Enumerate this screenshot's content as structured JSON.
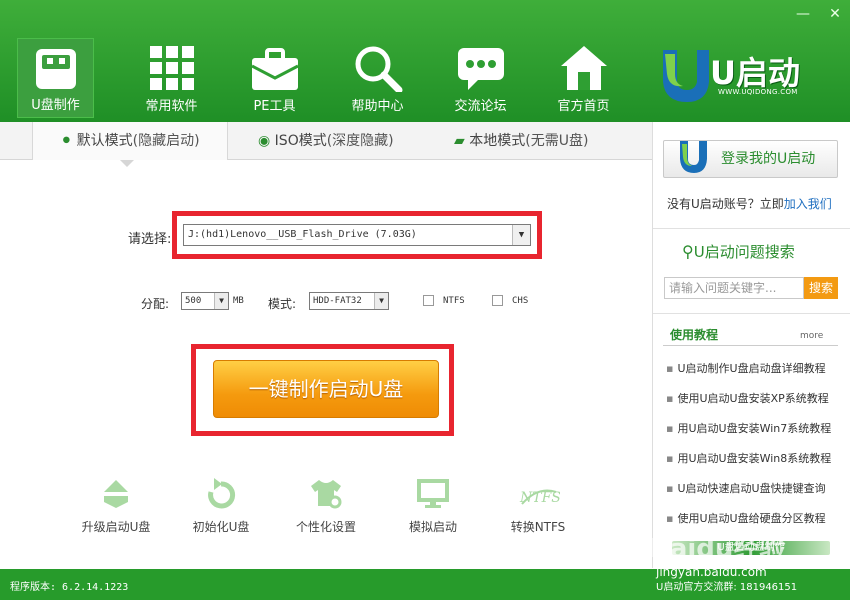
{
  "window": {
    "minimize_glyph": "—",
    "close_glyph": "✕"
  },
  "nav": {
    "items": [
      {
        "label": "U盘制作",
        "icon": "usb-drive-icon",
        "active": true
      },
      {
        "label": "常用软件",
        "icon": "grid-apps-icon",
        "active": false
      },
      {
        "label": "PE工具",
        "icon": "toolbox-icon",
        "active": false
      },
      {
        "label": "帮助中心",
        "icon": "magnifier-icon",
        "active": false
      },
      {
        "label": "交流论坛",
        "icon": "chat-bubble-icon",
        "active": false
      },
      {
        "label": "官方首页",
        "icon": "home-icon",
        "active": false
      }
    ]
  },
  "logo": {
    "text": "U启动",
    "url_text": "WWW.UQIDONG.COM"
  },
  "tabs": [
    {
      "label": "默认模式",
      "sub": "(隐藏启动)",
      "icon": "share-node-icon",
      "active": true
    },
    {
      "label": "ISO模式",
      "sub": "(深度隐藏)",
      "icon": "disc-icon",
      "active": false
    },
    {
      "label": "本地模式",
      "sub": "(无需U盘)",
      "icon": "hard-drive-icon",
      "active": false
    }
  ],
  "form": {
    "select_label": "请选择:",
    "drive_value": "J:(hd1)Lenovo__USB_Flash_Drive (7.03G)",
    "alloc_label": "分配:",
    "alloc_value": "500",
    "alloc_unit": "MB",
    "mode_label": "模式:",
    "mode_value": "HDD-FAT32",
    "ntfs_label": "NTFS",
    "ntfs_checked": false,
    "chs_label": "CHS",
    "chs_checked": false,
    "main_button": "一键制作启动U盘"
  },
  "tools": [
    {
      "label": "升级启动U盘",
      "icon": "upgrade-icon"
    },
    {
      "label": "初始化U盘",
      "icon": "reset-icon"
    },
    {
      "label": "个性化设置",
      "icon": "shirt-gear-icon"
    },
    {
      "label": "模拟启动",
      "icon": "monitor-icon"
    },
    {
      "label": "转换NTFS",
      "icon": "ntfs-icon"
    }
  ],
  "right": {
    "login_button": "登录我的U启动",
    "no_account_text": "没有U启动账号？立即",
    "join_link": "加入我们",
    "search_title": "U启动问题搜索",
    "search_placeholder": "请输入问题关键字...",
    "search_button": "搜索",
    "tutorial_title": "使用教程",
    "tutorial_more": "more",
    "tutorials": [
      "U启动制作U盘启动盘详细教程",
      "使用U启动U盘安装XP系统教程",
      "用U启动U盘安装Win7系统教程",
      "用U启动U盘安装Win8系统教程",
      "U启动快速启动U盘快捷键查询",
      "使用U启动U盘给硬盘分区教程"
    ],
    "bottom_bar": "U盘启动盘制作"
  },
  "footer": {
    "version": "程序版本: 6.2.14.1223",
    "qq_group": "U启动官方交流群: 181946151"
  },
  "watermark": {
    "main": "Baidu经验",
    "sub": "jingyan.baidu.com"
  },
  "colors": {
    "header_green": "#2f9f33",
    "accent_orange": "#f59a0e",
    "highlight_red": "#e8252f",
    "link_blue": "#1f6fc0"
  }
}
